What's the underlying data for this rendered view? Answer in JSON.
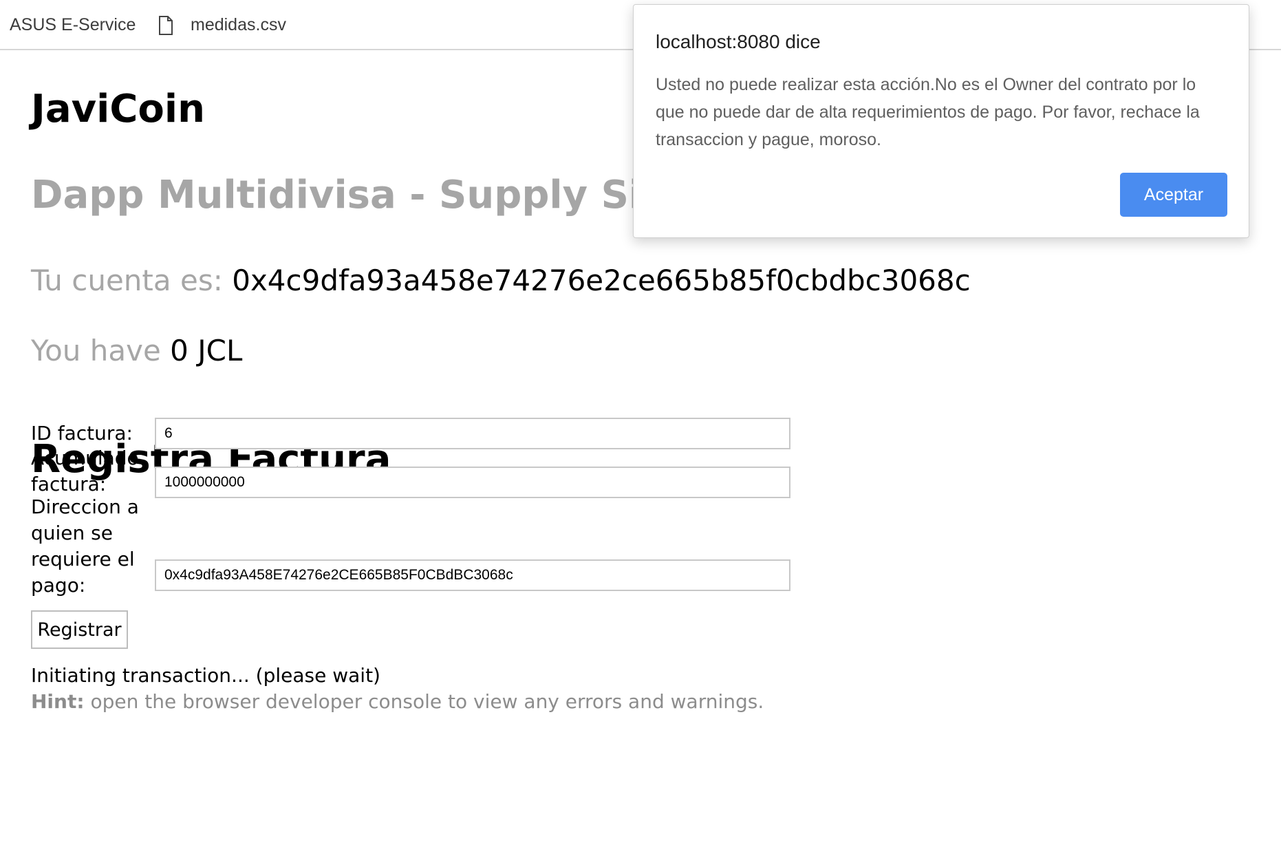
{
  "bookmarks": [
    {
      "label": "ASUS E-Service"
    },
    {
      "label": "medidas.csv",
      "icon": "file-icon"
    }
  ],
  "page": {
    "title": "JaviCoin",
    "subtitle": "Dapp Multidivisa - Supply Side",
    "account_prefix": "Tu cuenta es:",
    "account_value": "0x4c9dfa93a458e74276e2ce665b85f0cbdbc3068c",
    "balance_prefix": "You have",
    "balance_value": "0 JCL"
  },
  "form": {
    "section_title": "Registra Factura",
    "fields": [
      {
        "label": "ID factura:",
        "value": "6"
      },
      {
        "label": "Acumulado factura:",
        "value": "1000000000"
      },
      {
        "label": "Direccion a quien se requiere el pago:",
        "value": "0x4c9dfa93A458E74276e2CE665B85F0CBdBC3068c"
      }
    ],
    "submit_label": "Registrar"
  },
  "status": {
    "message": "Initiating transaction... (please wait)",
    "hint_label": "Hint:",
    "hint_text": " open the browser developer console to view any errors and warnings."
  },
  "dialog": {
    "title": "localhost:8080 dice",
    "message": "Usted no puede realizar esta acción.No es el Owner del contrato por lo que no puede dar de alta requerimientos de pago. Por favor, rechace la transaccion y pague, moroso.",
    "ok_label": "Aceptar",
    "ok_color": "#4a8cf0"
  }
}
